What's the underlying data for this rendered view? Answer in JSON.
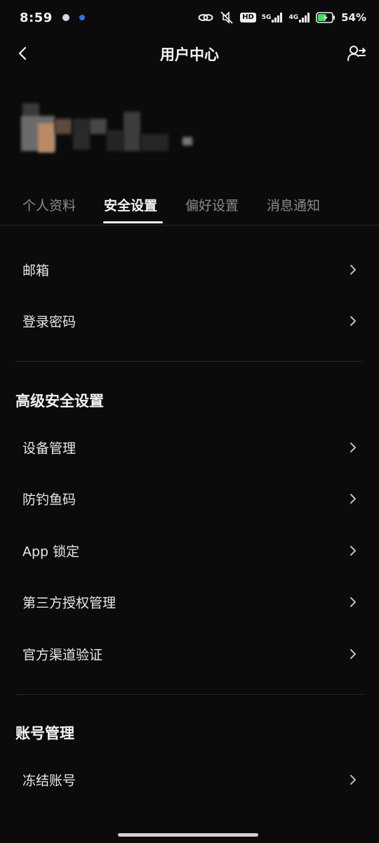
{
  "status_bar": {
    "time": "8:59",
    "hd_label": "HD",
    "net_5g": "5G",
    "net_4g": "4G",
    "battery_text": "54%",
    "icons": [
      "app-notification-icon",
      "app-notification-icon-2",
      "link-icon",
      "mute-icon",
      "hd-voice-icon",
      "signal-5g-icon",
      "signal-4g-icon",
      "battery-charging-icon"
    ]
  },
  "header": {
    "title": "用户中心",
    "back_icon": "chevron-left-icon",
    "right_icon": "switch-account-icon"
  },
  "tabs": [
    {
      "label": "个人资料"
    },
    {
      "label": "安全设置"
    },
    {
      "label": "偏好设置"
    },
    {
      "label": "消息通知"
    }
  ],
  "active_tab": "安全设置",
  "basic": {
    "items": [
      {
        "label": "邮箱"
      },
      {
        "label": "登录密码"
      }
    ]
  },
  "advanced": {
    "title": "高级安全设置",
    "items": [
      {
        "label": "设备管理"
      },
      {
        "label": "防钓鱼码"
      },
      {
        "label": "App 锁定"
      },
      {
        "label": "第三方授权管理"
      },
      {
        "label": "官方渠道验证"
      }
    ]
  },
  "account": {
    "title": "账号管理",
    "items": [
      {
        "label": "冻结账号"
      }
    ]
  },
  "colors": {
    "background": "#0b0b0b",
    "text_primary": "#f4f4f4",
    "text_secondary": "#8a8a8a",
    "divider": "#232323"
  }
}
